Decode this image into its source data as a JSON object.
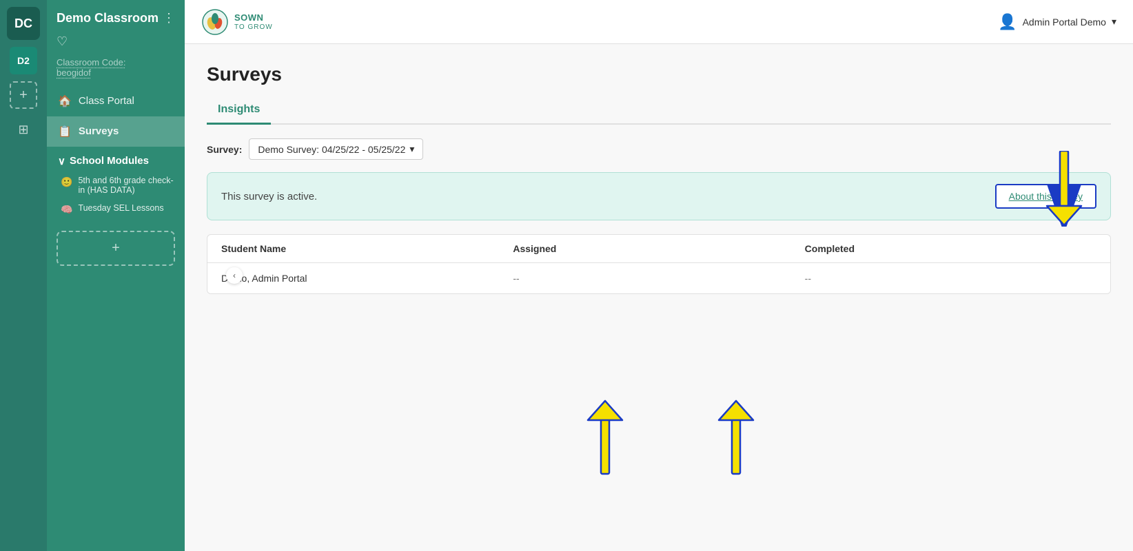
{
  "iconBar": {
    "initials": "DC",
    "d2Label": "D2",
    "addLabel": "+",
    "gridLabel": "⊞"
  },
  "sidebar": {
    "collapseIcon": "‹",
    "classroomName": "Demo Classroom",
    "heartIcon": "♡",
    "classroomCodeLabel": "Classroom Code:",
    "classroomCode": "beogidof",
    "navItems": [
      {
        "icon": "🏠",
        "label": "Class Portal",
        "active": false
      },
      {
        "icon": "📋",
        "label": "Surveys",
        "active": true
      }
    ],
    "schoolModulesLabel": "School Modules",
    "schoolModulesChevron": "∨",
    "modules": [
      {
        "icon": "🙂",
        "label": "5th and 6th grade check-in (HAS DATA)"
      },
      {
        "icon": "🧠",
        "label": "Tuesday SEL Lessons"
      }
    ],
    "addModuleIcon": "+"
  },
  "topbar": {
    "logoName": "SOWN",
    "logoSub": "TO GROW",
    "userName": "Admin Portal Demo",
    "userDropdownIcon": "▾",
    "userAccountIcon": "👤"
  },
  "page": {
    "title": "Surveys",
    "tabs": [
      {
        "label": "Insights",
        "active": true
      }
    ],
    "surveyFilterLabel": "Survey:",
    "surveyDropdownValue": "Demo Survey: 04/25/22 - 05/25/22",
    "surveyDropdownIcon": "▾",
    "bannerText": "This survey is active.",
    "aboutSurveyLabel": "About this survey",
    "tableHeaders": [
      "Student Name",
      "Assigned",
      "Completed"
    ],
    "tableRows": [
      {
        "name": "Demo, Admin Portal",
        "assigned": "--",
        "completed": "--"
      }
    ]
  }
}
